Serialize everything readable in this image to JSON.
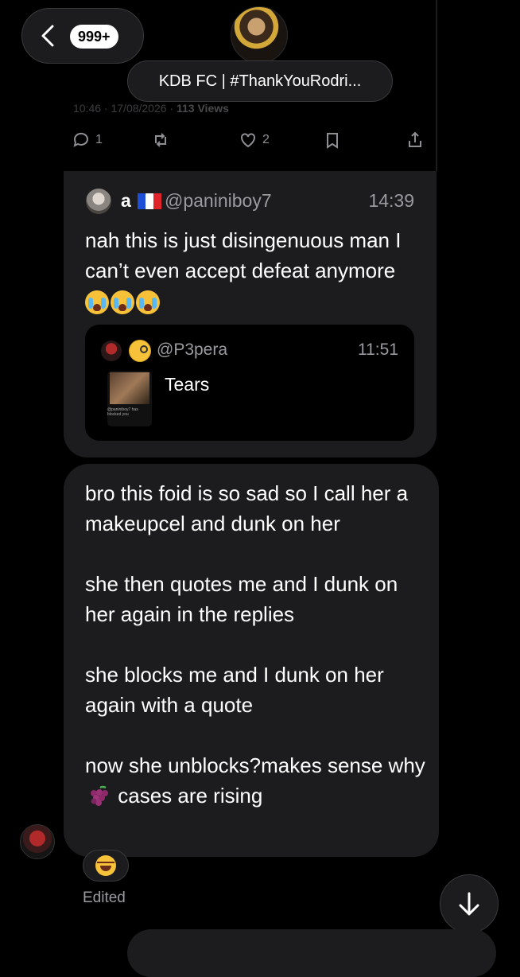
{
  "header": {
    "unread_badge": "999+",
    "group_title": "KDB FC | #ThankYouRodri..."
  },
  "background_tweet": {
    "timestamp": "10:46 · 17/08/2026 ·",
    "views": "113 Views",
    "actions": {
      "reply_count": "1",
      "like_count": "2"
    }
  },
  "message1": {
    "name": "a",
    "handle": "@paniniboy7",
    "time": "14:39",
    "text": "nah this is just disingenuous man I can’t even accept defeat anymore",
    "quote": {
      "handle": "@P3pera",
      "time": "11:51",
      "text": "Tears",
      "thumb_caption": "@paniniboy7 has blocked you"
    }
  },
  "message2": {
    "paragraph1": "bro this foid is so sad so I call her a makeupcel and dunk on her",
    "paragraph2": "she then quotes me and I dunk on her again in the replies",
    "paragraph3": "she blocks me and I dunk on her again with a quote",
    "paragraph4_part1": "now she unblocks?makes sense why",
    "paragraph4_part2": "cases are rising",
    "edited_label": "Edited"
  },
  "colors": {
    "background": "#000000",
    "bubble": "#1c1c1e",
    "secondary_text": "#9a9aa0",
    "border": "#3a3a3c"
  }
}
